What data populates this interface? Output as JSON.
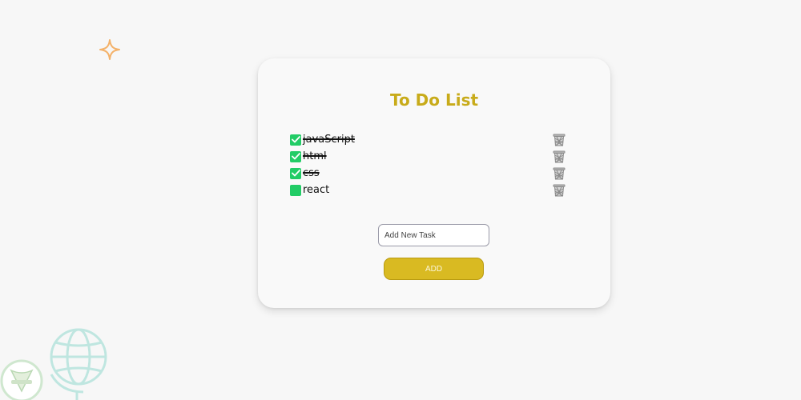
{
  "app": {
    "title": "To Do List"
  },
  "tasks": [
    {
      "label": "javaScript",
      "done": true
    },
    {
      "label": "html",
      "done": true
    },
    {
      "label": "css",
      "done": true
    },
    {
      "label": "react",
      "done": false
    }
  ],
  "input": {
    "value": "",
    "placeholder": "Add New Task"
  },
  "buttons": {
    "add_label": "ADD"
  },
  "icons": {
    "checkbox": "checkbox-icon",
    "delete": "trash-icon",
    "sparkle": "sparkle-icon",
    "globe": "globe-icon",
    "badge": "badge-icon"
  },
  "colors": {
    "background": "#f7f7f7",
    "card": "#f9f9f9",
    "accent": "#c8ab1a",
    "button": "#d9ba22",
    "checkbox": "#22cc66",
    "sparkle": "#f4b26a",
    "globe": "#bfe6e0"
  }
}
